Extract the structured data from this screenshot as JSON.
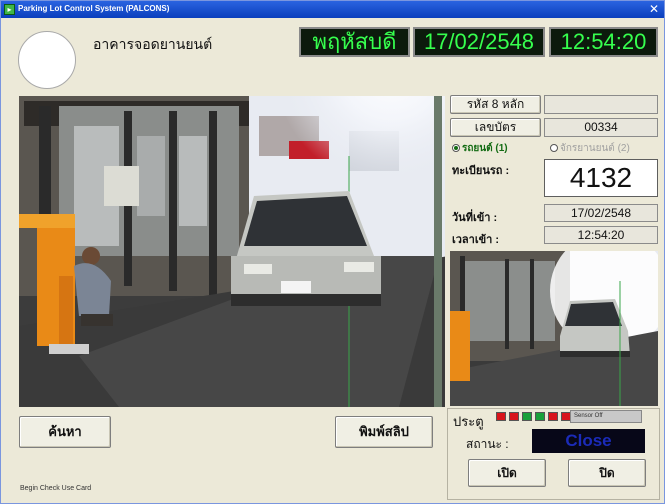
{
  "window": {
    "title": "Parking Lot Control System (PALCONS)"
  },
  "header": {
    "building_name": "อาคารจอดยานยนต์",
    "day": "พฤหัสบดี",
    "date": "17/02/2548",
    "time": "12:54:20"
  },
  "info": {
    "code_button": "รหัส 8 หลัก",
    "code_value": "",
    "card_button": "เลขบัตร",
    "card_value": "00334",
    "radio_car": "รถยนต์ (1)",
    "radio_moto": "จักรยานยนต์ (2)",
    "plate_label": "ทะเบียนรถ :",
    "plate_value": "4132",
    "date_in_label": "วันที่เข้า :",
    "date_in_value": "17/02/2548",
    "time_in_label": "เวลาเข้า :",
    "time_in_value": "12:54:20"
  },
  "gate": {
    "label": "ประตู",
    "sensor_text": "Sensor Off",
    "leds": [
      "#d8141b",
      "#d8141b",
      "#19a03a",
      "#19a03a",
      "#d8141b",
      "#d8141b",
      "#d8141b"
    ],
    "status_label": "สถานะ :",
    "status_value": "Close",
    "open_button": "เปิด",
    "close_button": "ปิด"
  },
  "actions": {
    "search_button": "ค้นหา",
    "print_button": "พิมพ์สลิป"
  },
  "statusbar": {
    "text": "Begin Check Use Card"
  },
  "colors": {
    "lcd_text": "#36ff4e",
    "lcd_bg": "#0c1a0c",
    "title_bar": "#0a3fbd"
  }
}
